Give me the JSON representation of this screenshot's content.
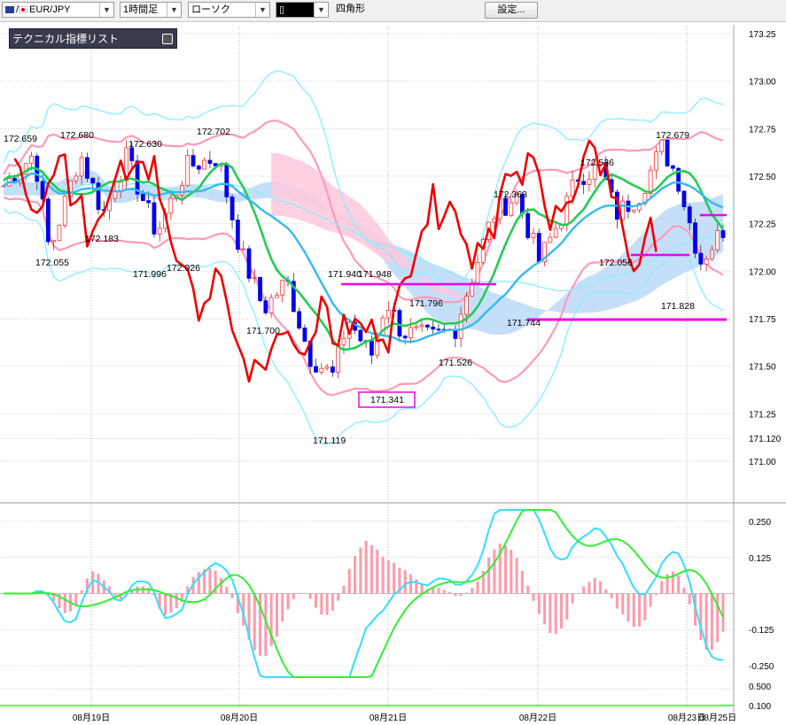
{
  "toolbar": {
    "symbol": "EUR/JPY",
    "symbol_prefix": "/",
    "timeframe": "1時間足",
    "chart_type": "ローソク",
    "drawing_tool": "四角形",
    "settings_label": "設定..."
  },
  "panel": {
    "title": "テクニカル指標リスト"
  },
  "colors": {
    "bull_candle": "#ff3333",
    "bear_candle": "#0000ee",
    "ma_fast": "#22cc55",
    "ma_mid": "#33bbee",
    "bollinger_outer": "#88eeff",
    "bollinger_inner": "#ff99bb",
    "kumo_bull": "#ffc8dc",
    "kumo_bear": "#c0dcf8",
    "chikou": "#ee0000",
    "highlight": "#ee00ee",
    "macd_line": "#33ddff",
    "signal_line": "#33ee33",
    "histogram": "#ff9aaa"
  },
  "chart_data": {
    "type": "candlestick",
    "symbol": "EUR/JPY",
    "timeframe": "1時間足",
    "ylim": [
      171.0,
      173.25
    ],
    "price_axis_labels": [
      "173.25",
      "173.00",
      "172.75",
      "172.50",
      "172.25",
      "172.00",
      "171.75",
      "171.50",
      "171.25",
      "171.120",
      "171.00"
    ],
    "date_labels": [
      "08月19日",
      "08月20日",
      "08月21日",
      "08月22日",
      "08月23日",
      "08月25日"
    ],
    "annotations": [
      {
        "text": "172.659",
        "value": 172.659
      },
      {
        "text": "172.680",
        "value": 172.68
      },
      {
        "text": "172.630",
        "value": 172.63
      },
      {
        "text": "172.702",
        "value": 172.702
      },
      {
        "text": "172.183",
        "value": 172.183
      },
      {
        "text": "172.055",
        "value": 172.055
      },
      {
        "text": "171.996",
        "value": 171.996
      },
      {
        "text": "172.026",
        "value": 172.026
      },
      {
        "text": "171.940",
        "value": 171.94
      },
      {
        "text": "171.948",
        "value": 171.948
      },
      {
        "text": "171.700",
        "value": 171.7
      },
      {
        "text": "171.796",
        "value": 171.796
      },
      {
        "text": "171.526",
        "value": 171.526
      },
      {
        "text": "171.341",
        "value": 171.341
      },
      {
        "text": "171.119",
        "value": 171.119
      },
      {
        "text": "172.363",
        "value": 172.363
      },
      {
        "text": "171.744",
        "value": 171.744
      },
      {
        "text": "172.536",
        "value": 172.536
      },
      {
        "text": "172.679",
        "value": 172.679
      },
      {
        "text": "172.056",
        "value": 172.056
      },
      {
        "text": "171.828",
        "value": 171.828
      }
    ],
    "oscillator": {
      "axis_labels": [
        "0.250",
        "0.125",
        "-0.125",
        "-0.250"
      ],
      "axis_values": [
        0.25,
        0.125,
        -0.125,
        -0.25
      ],
      "ylim": [
        -0.29,
        0.29
      ]
    },
    "sub_axis_labels": [
      "0.500",
      "0.100"
    ]
  }
}
